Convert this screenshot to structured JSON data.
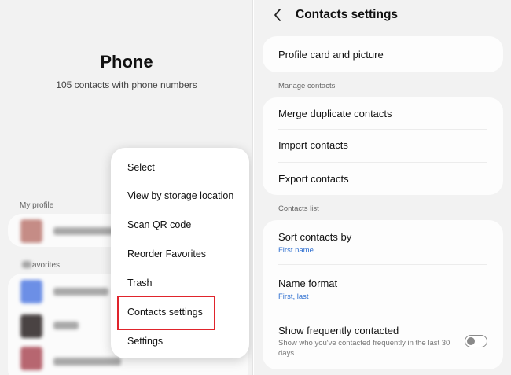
{
  "phone": {
    "title": "Phone",
    "subtitle": "105 contacts with phone numbers",
    "my_profile_label": "My profile",
    "favorites_label": "avorites"
  },
  "menu": {
    "items": [
      {
        "label": "Select"
      },
      {
        "label": "View by storage location"
      },
      {
        "label": "Scan QR code"
      },
      {
        "label": "Reorder Favorites"
      },
      {
        "label": "Trash"
      },
      {
        "label": "Contacts settings"
      },
      {
        "label": "Settings"
      }
    ],
    "highlighted": "Contacts settings"
  },
  "settings": {
    "title": "Contacts settings",
    "profile_card": "Profile card and picture",
    "manage_section": "Manage contacts",
    "manage_items": [
      {
        "label": "Merge duplicate contacts"
      },
      {
        "label": "Import contacts"
      },
      {
        "label": "Export contacts"
      }
    ],
    "list_section": "Contacts list",
    "sort": {
      "label": "Sort contacts by",
      "value": "First name"
    },
    "name_format": {
      "label": "Name format",
      "value": "First, last"
    },
    "frequent": {
      "label": "Show frequently contacted",
      "description": "Show who you've contacted frequently in the last 30 days.",
      "enabled": false
    }
  },
  "colors": {
    "accent_link": "#2e6fd0",
    "highlight_border": "#e0242c",
    "background": "#f2f2f2"
  },
  "icons": [
    "back-arrow-icon",
    "toggle-switch"
  ]
}
